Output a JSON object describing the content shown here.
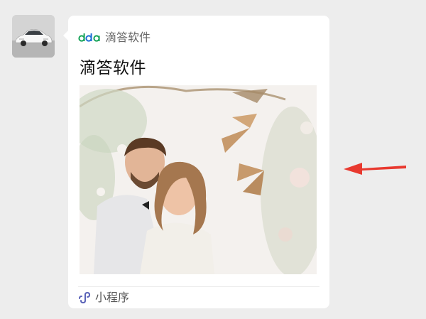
{
  "message": {
    "sender_avatar": "white-sports-car-photo",
    "card": {
      "app_logo": "dda-logo",
      "app_name": "滴答软件",
      "title": "滴答软件",
      "cover_image": "wedding-couple-photo",
      "footer_icon": "mini-program-icon",
      "footer_label": "小程序"
    }
  },
  "annotation": {
    "arrow_color": "#e8392f"
  },
  "colors": {
    "background": "#ededed",
    "card": "#ffffff",
    "logo_green": "#19a45a",
    "logo_blue": "#1f6fd6",
    "mini_program_icon": "#5a63b8"
  }
}
